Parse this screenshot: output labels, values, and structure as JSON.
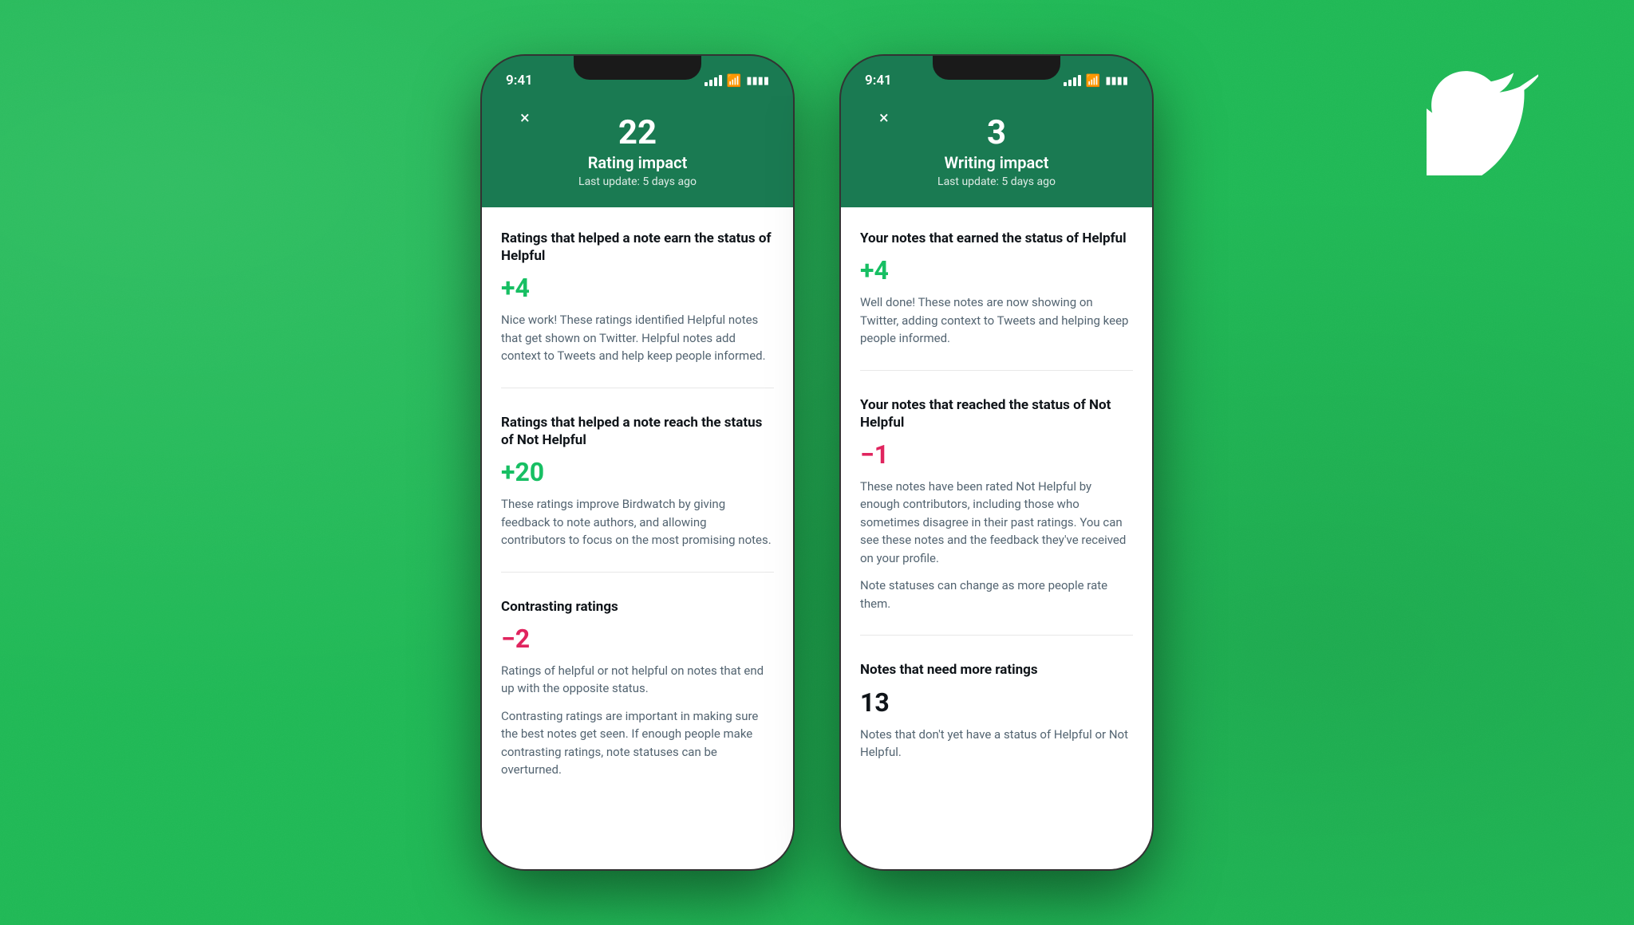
{
  "background_color": "#1db954",
  "twitter_logo": {
    "alt": "Twitter bird logo"
  },
  "phone1": {
    "status_time": "9:41",
    "header": {
      "number": "22",
      "title": "Rating impact",
      "subtitle": "Last update: 5 days ago",
      "close_label": "×"
    },
    "sections": [
      {
        "title": "Ratings that helped a note earn the status of Helpful",
        "value": "+4",
        "value_color": "green",
        "description": "Nice work! These ratings identified Helpful notes that get shown on Twitter. Helpful notes add context to Tweets and help keep people informed."
      },
      {
        "title": "Ratings that helped a note reach the status of Not Helpful",
        "value": "+20",
        "value_color": "green",
        "description": "These ratings improve Birdwatch by giving feedback to note authors, and allowing contributors to focus on the most promising notes."
      },
      {
        "title": "Contrasting ratings",
        "value": "−2",
        "value_color": "pink",
        "description": "Ratings of helpful or not helpful on notes that end up with the opposite status.",
        "extra_description": "Contrasting ratings are important in making sure the best notes get seen. If enough people make contrasting ratings, note statuses can be overturned."
      }
    ]
  },
  "phone2": {
    "status_time": "9:41",
    "header": {
      "number": "3",
      "title": "Writing impact",
      "subtitle": "Last update: 5 days ago",
      "close_label": "×"
    },
    "sections": [
      {
        "title": "Your notes that earned the status of Helpful",
        "value": "+4",
        "value_color": "green",
        "description": "Well done! These notes are now showing on Twitter, adding context to Tweets and helping keep people informed."
      },
      {
        "title": "Your notes that reached the status of Not Helpful",
        "value": "−1",
        "value_color": "pink",
        "description": "These notes have been rated Not Helpful by enough contributors, including those who sometimes disagree in their past ratings. You can see these notes and the feedback they've received on your profile.",
        "extra_description": "Note statuses can change as more people rate them."
      },
      {
        "title": "Notes that need more ratings",
        "value": "13",
        "value_color": "black",
        "description": "Notes that don't yet have a status of Helpful or Not Helpful."
      }
    ]
  }
}
